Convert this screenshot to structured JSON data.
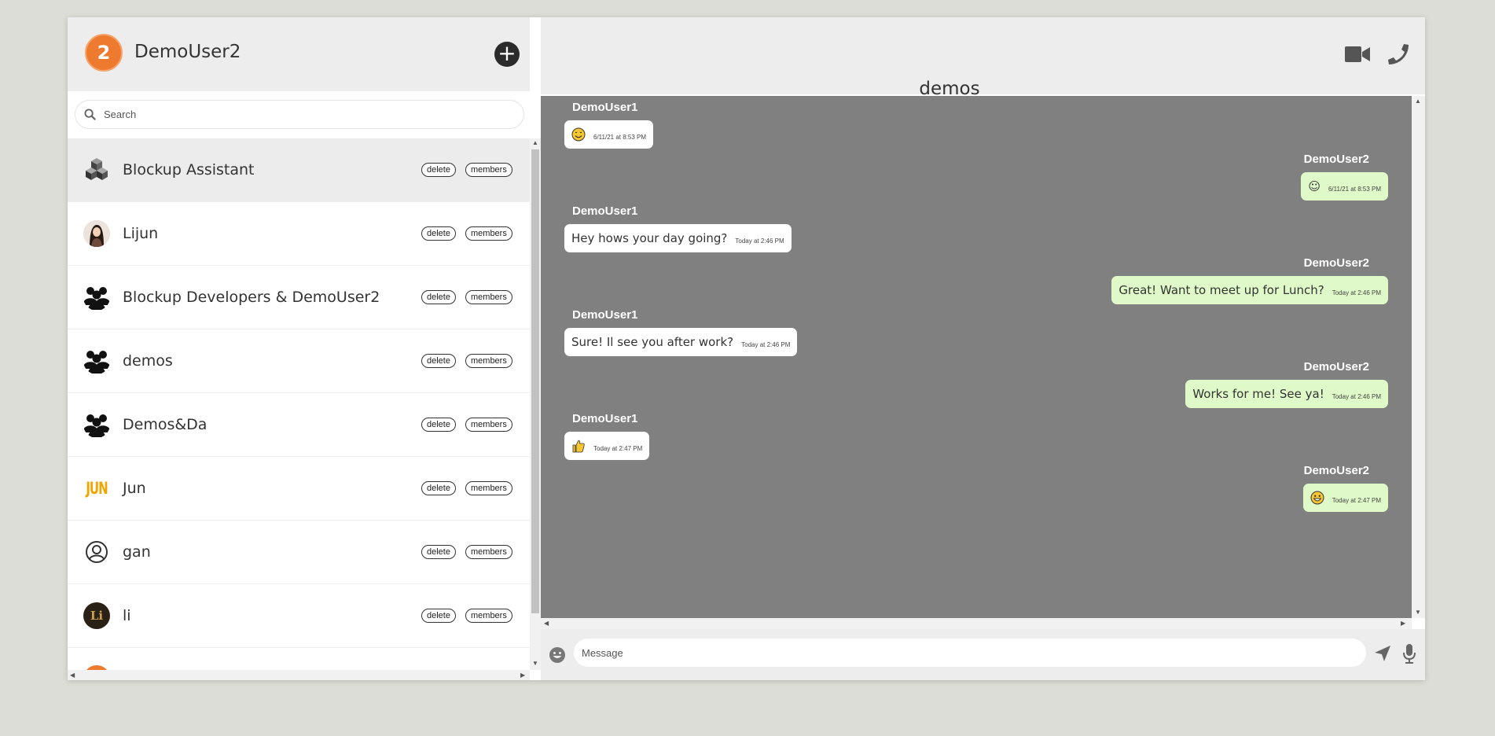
{
  "user": {
    "avatar_text": "2",
    "name": "DemoUser2"
  },
  "add_button": "+",
  "search": {
    "placeholder": "Search"
  },
  "conversations": [
    {
      "name": "Blockup Assistant",
      "avatar": "blocks-logo-icon",
      "active": true,
      "delete_label": "delete",
      "members_label": "members"
    },
    {
      "name": "Lijun",
      "avatar": "photo-avatar",
      "delete_label": "delete",
      "members_label": "members"
    },
    {
      "name": "Blockup Developers & DemoUser2",
      "avatar": "group-icon",
      "delete_label": "delete",
      "members_label": "members"
    },
    {
      "name": "demos",
      "avatar": "group-icon",
      "delete_label": "delete",
      "members_label": "members"
    },
    {
      "name": "Demos&Da",
      "avatar": "group-icon",
      "delete_label": "delete",
      "members_label": "members"
    },
    {
      "name": "Jun",
      "avatar": "jun-logo",
      "avatar_text": "JUN",
      "delete_label": "delete",
      "members_label": "members"
    },
    {
      "name": "gan",
      "avatar": "user-circle-icon",
      "delete_label": "delete",
      "members_label": "members"
    },
    {
      "name": "li",
      "avatar": "li-logo",
      "avatar_text": "Li",
      "delete_label": "delete",
      "members_label": "members"
    }
  ],
  "chat": {
    "title": "demos",
    "messages": [
      {
        "sender": "DemoUser1",
        "direction": "in",
        "text": "",
        "emoji": "smile-emoji",
        "time": "6/11/21 at 8:53 PM"
      },
      {
        "sender": "DemoUser2",
        "direction": "out",
        "text": "☺",
        "time": "6/11/21 at 8:53 PM"
      },
      {
        "sender": "DemoUser1",
        "direction": "in",
        "text": "Hey hows your day going?",
        "time": "Today at 2:46 PM"
      },
      {
        "sender": "DemoUser2",
        "direction": "out",
        "text": "Great! Want to meet up for Lunch?",
        "time": "Today at 2:46 PM"
      },
      {
        "sender": "DemoUser1",
        "direction": "in",
        "text": "Sure! Il see you after work?",
        "time": "Today at 2:46 PM"
      },
      {
        "sender": "DemoUser2",
        "direction": "out",
        "text": "Works for me! See ya!",
        "time": "Today at 2:46 PM"
      },
      {
        "sender": "DemoUser1",
        "direction": "in",
        "text": "",
        "emoji": "thumbs-up-emoji",
        "time": "Today at 2:47 PM"
      },
      {
        "sender": "DemoUser2",
        "direction": "out",
        "text": "",
        "emoji": "grin-emoji",
        "time": "Today at 2:47 PM"
      }
    ]
  },
  "composer": {
    "placeholder": "Message"
  },
  "colors": {
    "accent": "#ee7a30",
    "chat_bg": "#808080",
    "bubble_out": "#dff9c8",
    "bubble_in": "#ffffff",
    "header_bg": "#ededed"
  }
}
